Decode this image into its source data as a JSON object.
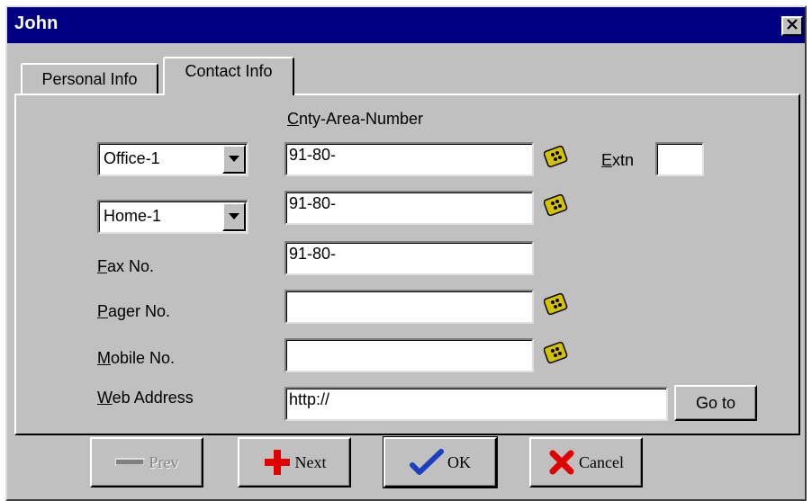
{
  "window": {
    "title": "John"
  },
  "tabs": [
    {
      "label": "Personal Info",
      "active": false
    },
    {
      "label": "Contact Info",
      "active": true
    }
  ],
  "form": {
    "column_header": "Cnty-Area-Number",
    "rows": [
      {
        "type_label": "Office-1",
        "value": "91-80-",
        "has_dial": true
      },
      {
        "type_label": "Home-1",
        "value": "91-80-",
        "has_dial": true
      },
      {
        "label": "Fax No.",
        "value": "91-80-",
        "has_dial": false
      },
      {
        "label": "Pager No.",
        "value": "",
        "has_dial": true
      },
      {
        "label": "Mobile No.",
        "value": "",
        "has_dial": true
      }
    ],
    "extn_label": "Extn",
    "extn_value": "",
    "web_label": "Web Address",
    "web_value": "http://",
    "goto_label": "Go to"
  },
  "buttons": {
    "prev": {
      "label": "Prev",
      "enabled": false
    },
    "next": {
      "label": "Next"
    },
    "ok": {
      "label": "OK"
    },
    "cancel": {
      "label": "Cancel"
    }
  },
  "colors": {
    "titlebar": "#000080",
    "face": "#c0c0c0",
    "next_plus": "#e00000",
    "ok_check": "#1a3fbf",
    "cancel_x": "#e00000",
    "dial_icon": "#d4c200"
  },
  "icons": [
    "close-icon",
    "chevron-down-icon",
    "phone-dial-icon",
    "prev-arrow-icon",
    "plus-icon",
    "checkmark-icon",
    "x-icon"
  ]
}
